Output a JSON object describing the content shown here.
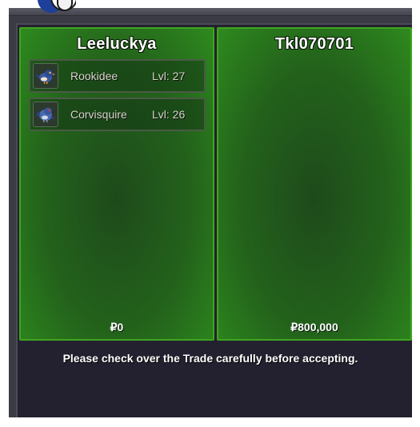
{
  "left_trader": {
    "name": "Leeluckya",
    "pokemon": [
      {
        "name": "Rookidee",
        "level": "Lvl: 27",
        "icon": "rookidee-sprite-icon"
      },
      {
        "name": "Corvisquire",
        "level": "Lvl: 26",
        "icon": "corvisquire-sprite-icon"
      }
    ],
    "money": "₽0"
  },
  "right_trader": {
    "name": "Tkl070701",
    "pokemon": [],
    "money": "₽800,000"
  },
  "notice": "Please check over the Trade carefully before accepting.",
  "colors": {
    "panel_border": "#3fa51f",
    "panel_fill": "#23621b",
    "window_bg": "#23212f"
  }
}
